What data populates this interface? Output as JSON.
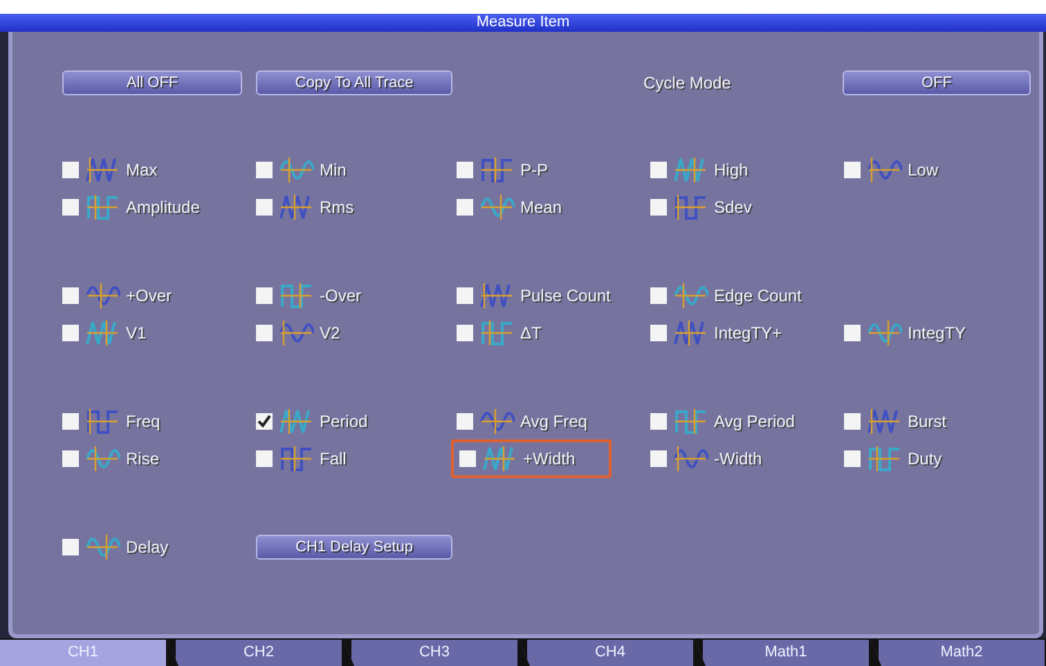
{
  "window": {
    "title": "Measure Item"
  },
  "top_buttons": [
    {
      "label": "All OFF"
    },
    {
      "label": "Copy To All Trace"
    }
  ],
  "cycle_mode": {
    "label": "Cycle Mode",
    "value": "OFF"
  },
  "groups": [
    {
      "rows": [
        [
          {
            "label": "Max",
            "checked": false,
            "focused": false
          },
          {
            "label": "Min",
            "checked": false,
            "focused": false
          },
          {
            "label": "P-P",
            "checked": false,
            "focused": false
          },
          {
            "label": "High",
            "checked": false,
            "focused": false
          },
          {
            "label": "Low",
            "checked": false,
            "focused": false
          }
        ],
        [
          {
            "label": "Amplitude",
            "checked": false,
            "focused": false
          },
          {
            "label": "Rms",
            "checked": false,
            "focused": false
          },
          {
            "label": "Mean",
            "checked": false,
            "focused": false
          },
          {
            "label": "Sdev",
            "checked": false,
            "focused": false
          }
        ]
      ]
    },
    {
      "rows": [
        [
          {
            "label": "+Over",
            "checked": false,
            "focused": false
          },
          {
            "label": "-Over",
            "checked": false,
            "focused": false
          },
          {
            "label": "Pulse Count",
            "checked": false,
            "focused": false
          },
          {
            "label": "Edge Count",
            "checked": false,
            "focused": false
          }
        ],
        [
          {
            "label": "V1",
            "checked": false,
            "focused": false
          },
          {
            "label": "V2",
            "checked": false,
            "focused": false
          },
          {
            "label": "ΔT",
            "checked": false,
            "focused": false
          },
          {
            "label": "IntegTY+",
            "checked": false,
            "focused": false
          },
          {
            "label": "IntegTY",
            "checked": false,
            "focused": false
          }
        ]
      ]
    },
    {
      "rows": [
        [
          {
            "label": "Freq",
            "checked": false,
            "focused": false
          },
          {
            "label": "Period",
            "checked": true,
            "focused": false
          },
          {
            "label": "Avg Freq",
            "checked": false,
            "focused": false
          },
          {
            "label": "Avg Period",
            "checked": false,
            "focused": false
          },
          {
            "label": "Burst",
            "checked": false,
            "focused": false
          }
        ],
        [
          {
            "label": "Rise",
            "checked": false,
            "focused": false
          },
          {
            "label": "Fall",
            "checked": false,
            "focused": false
          },
          {
            "label": "+Width",
            "checked": false,
            "focused": true
          },
          {
            "label": "-Width",
            "checked": false,
            "focused": false
          },
          {
            "label": "Duty",
            "checked": false,
            "focused": false
          }
        ]
      ]
    }
  ],
  "delay": {
    "item": {
      "label": "Delay",
      "checked": false,
      "focused": false
    },
    "button": "CH1 Delay Setup"
  },
  "tabs": [
    {
      "label": "CH1",
      "selected": true
    },
    {
      "label": "CH2",
      "selected": false
    },
    {
      "label": "CH3",
      "selected": false
    },
    {
      "label": "CH4",
      "selected": false
    },
    {
      "label": "Math1",
      "selected": false
    },
    {
      "label": "Math2",
      "selected": false
    }
  ]
}
